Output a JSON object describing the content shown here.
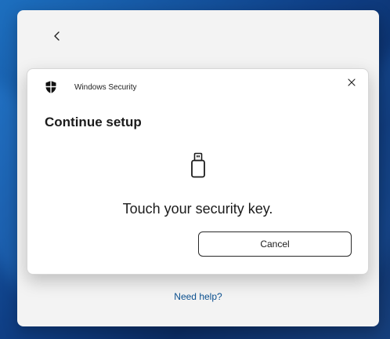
{
  "outer_window": {
    "help_link": "Need help?"
  },
  "dialog": {
    "app_title": "Windows Security",
    "title": "Continue setup",
    "prompt": "Touch your security key.",
    "cancel_label": "Cancel"
  },
  "icons": {
    "back": "chevron-left-icon",
    "shield": "shield-icon",
    "close": "close-icon",
    "security_key": "usb-security-key-icon"
  }
}
